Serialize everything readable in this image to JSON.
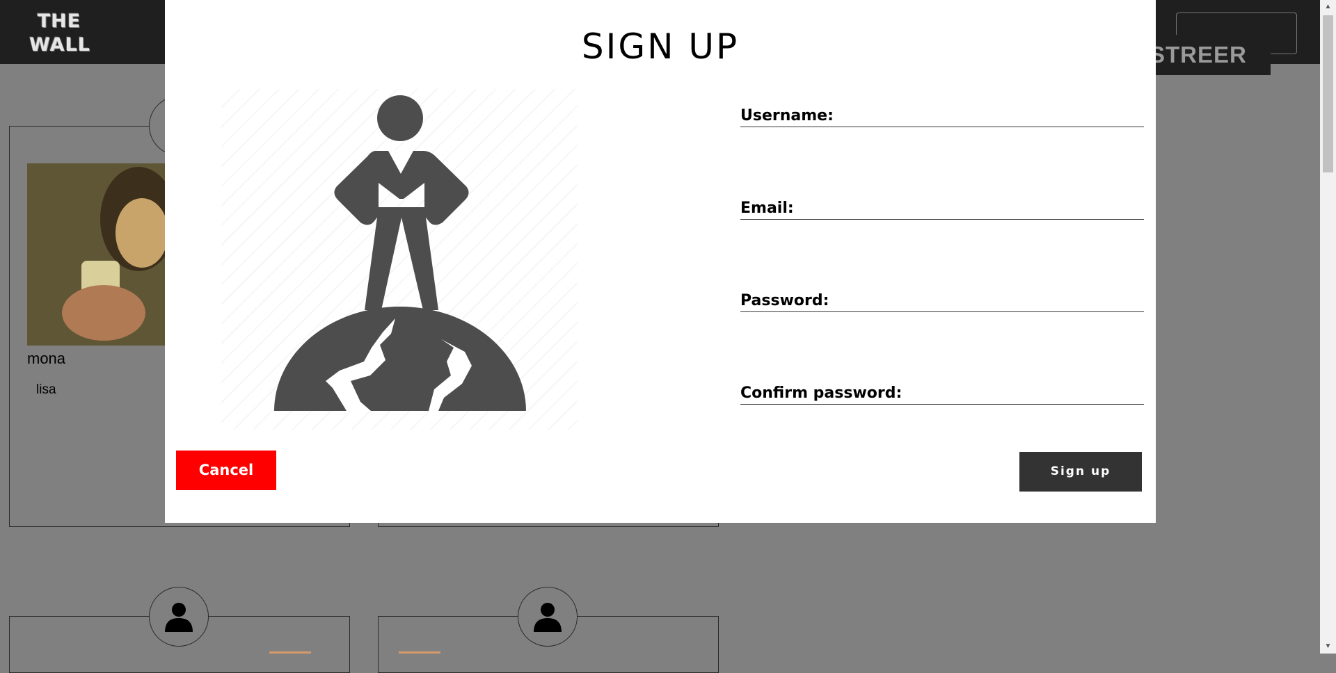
{
  "header": {
    "logo_line1": "THE",
    "logo_line2": "WALL",
    "nav_button": "STREER"
  },
  "cards": [
    {
      "name": "mona",
      "subtitle": "lisa"
    }
  ],
  "modal": {
    "title": "SIGN UP",
    "fields": [
      {
        "label": "Username:",
        "value": ""
      },
      {
        "label": "Email:",
        "value": ""
      },
      {
        "label": "Password:",
        "value": ""
      },
      {
        "label": "Confirm password:",
        "value": ""
      }
    ],
    "cancel_label": "Cancel",
    "submit_label": "Sign up"
  },
  "icons": {
    "hero": "person-on-globe-icon",
    "avatar": "user-icon"
  },
  "colors": {
    "cancel": "#ff0000",
    "submit": "#333333",
    "overlay": "#808080",
    "topbar": "#1f1f1f"
  }
}
